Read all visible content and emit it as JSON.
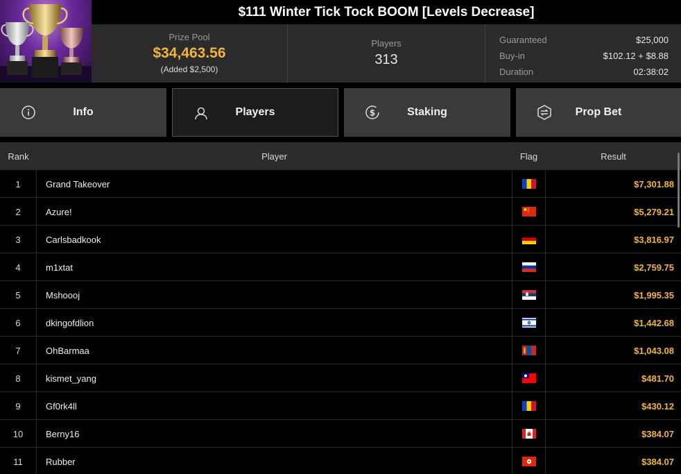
{
  "title": "$111 Winter Tick Tock BOOM [Levels Decrease]",
  "prize_pool": {
    "label": "Prize Pool",
    "value": "$34,463.56",
    "added": "(Added $2,500)"
  },
  "players": {
    "label": "Players",
    "value": "313"
  },
  "details": {
    "guaranteed_label": "Guaranteed",
    "guaranteed_value": "$25,000",
    "buyin_label": "Buy-in",
    "buyin_value": "$102.12 + $8.88",
    "duration_label": "Duration",
    "duration_value": "02:38:02"
  },
  "tabs": [
    {
      "label": "Info",
      "icon": "info-icon"
    },
    {
      "label": "Players",
      "icon": "user-icon"
    },
    {
      "label": "Staking",
      "icon": "dollar-coin-icon"
    },
    {
      "label": "Prop Bet",
      "icon": "prop-bet-icon"
    }
  ],
  "active_tab": "Players",
  "table": {
    "headers": {
      "rank": "Rank",
      "player": "Player",
      "flag": "Flag",
      "result": "Result"
    },
    "rows": [
      {
        "rank": "1",
        "player": "Grand Takeover",
        "flag": "andorra",
        "result": "$7,301.88"
      },
      {
        "rank": "2",
        "player": "Azure!",
        "flag": "china",
        "result": "$5,279.21"
      },
      {
        "rank": "3",
        "player": "Carlsbadkook",
        "flag": "germany",
        "result": "$3,816.97"
      },
      {
        "rank": "4",
        "player": "m1xtat",
        "flag": "russia",
        "result": "$2,759.75"
      },
      {
        "rank": "5",
        "player": "Mshoooj",
        "flag": "serbia",
        "result": "$1,995.35"
      },
      {
        "rank": "6",
        "player": "dkingofdlion",
        "flag": "israel",
        "result": "$1,442.68"
      },
      {
        "rank": "7",
        "player": "OhBarmaa",
        "flag": "mongolia",
        "result": "$1,043.08"
      },
      {
        "rank": "8",
        "player": "kismet_yang",
        "flag": "taiwan",
        "result": "$481.70"
      },
      {
        "rank": "9",
        "player": "Gf0rk4ll",
        "flag": "andorra",
        "result": "$430.12"
      },
      {
        "rank": "10",
        "player": "Berny16",
        "flag": "canada",
        "result": "$384.07"
      },
      {
        "rank": "11",
        "player": "Rubber",
        "flag": "hong-kong",
        "result": "$384.07"
      }
    ]
  },
  "colors": {
    "accent_gold": "#f2b53a",
    "tab_bg": "#3a3a3a",
    "tab_active_bg": "#1c1c1c",
    "header_bg": "#2b2b2b"
  }
}
